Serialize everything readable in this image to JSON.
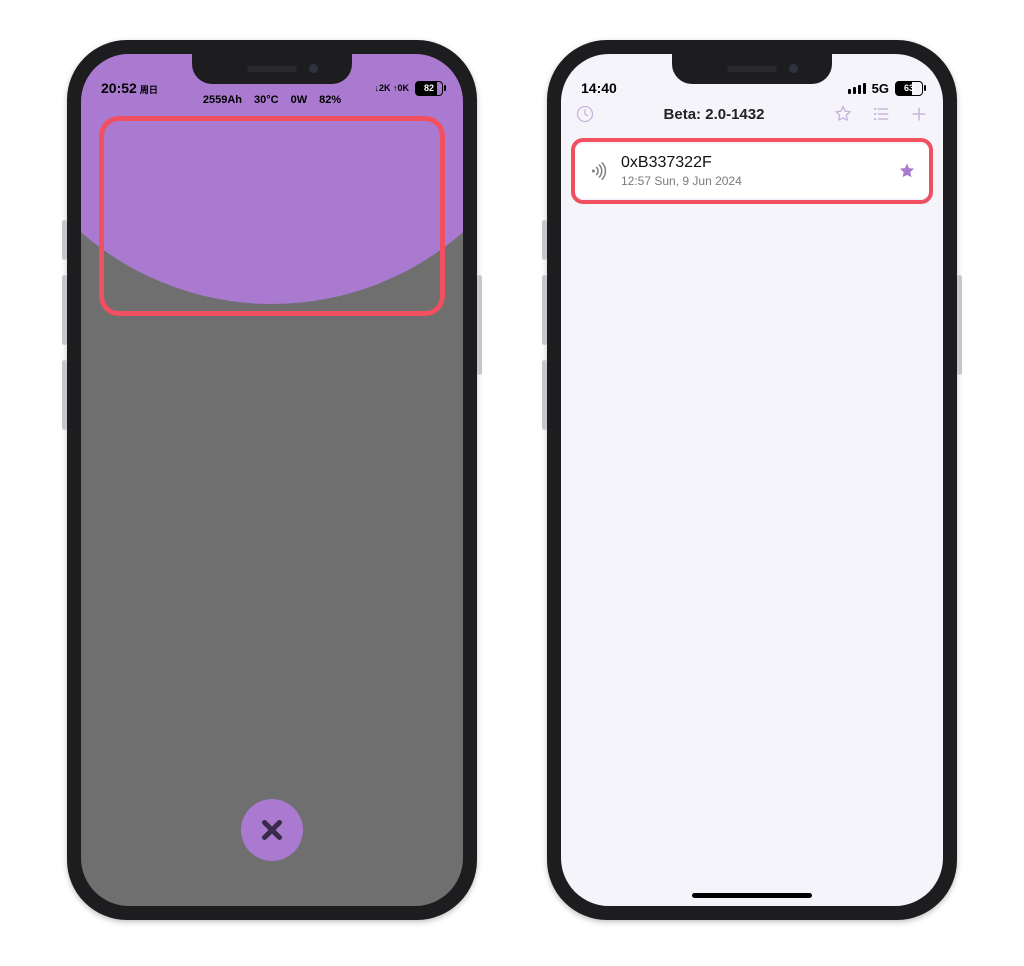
{
  "colors": {
    "accent": "#aa7ad0",
    "highlight": "#f05060"
  },
  "left": {
    "status": {
      "time": "20:52",
      "day_label": "周日",
      "battery_pct": "82",
      "extra_icon_label": "↓2K ↑0K"
    },
    "mini_stats": {
      "capacity": "2559Ah",
      "temp": "30°C",
      "power": "0W",
      "soc": "82%"
    },
    "close_label": "close"
  },
  "right": {
    "status": {
      "time": "14:40",
      "network": "5G",
      "battery_pct": "63"
    },
    "toolbar": {
      "title": "Beta: 2.0-1432"
    },
    "device": {
      "name": "0xB337322F",
      "timestamp": "12:57 Sun, 9 Jun 2024"
    }
  }
}
